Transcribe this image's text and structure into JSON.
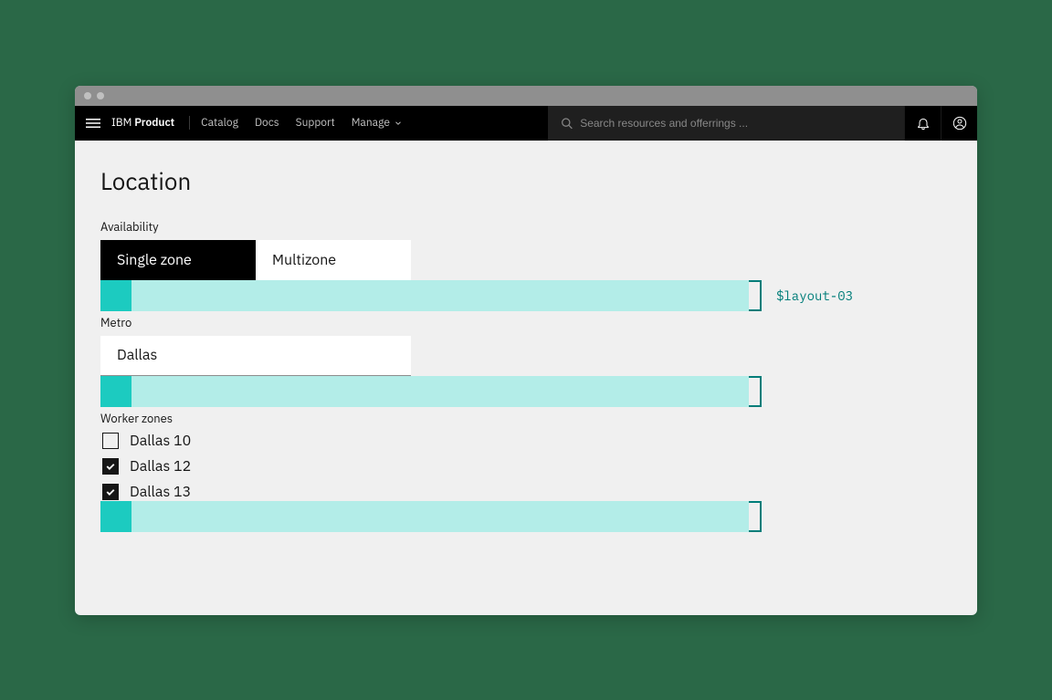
{
  "header": {
    "brand_prefix": "IBM",
    "brand_product": "Product",
    "nav": [
      "Catalog",
      "Docs",
      "Support"
    ],
    "manage_label": "Manage",
    "search_placeholder": "Search resources and offerrings ..."
  },
  "page": {
    "title": "Location"
  },
  "availability": {
    "label": "Availability",
    "tabs": [
      {
        "label": "Single zone",
        "active": true
      },
      {
        "label": "Multizone",
        "active": false
      }
    ]
  },
  "metro": {
    "label": "Metro",
    "value": "Dallas"
  },
  "worker_zones": {
    "label": "Worker zones",
    "items": [
      {
        "label": "Dallas 10",
        "checked": false
      },
      {
        "label": "Dallas 12",
        "checked": true
      },
      {
        "label": "Dallas 13",
        "checked": true
      }
    ]
  },
  "annotations": {
    "token": "$layout-03"
  }
}
